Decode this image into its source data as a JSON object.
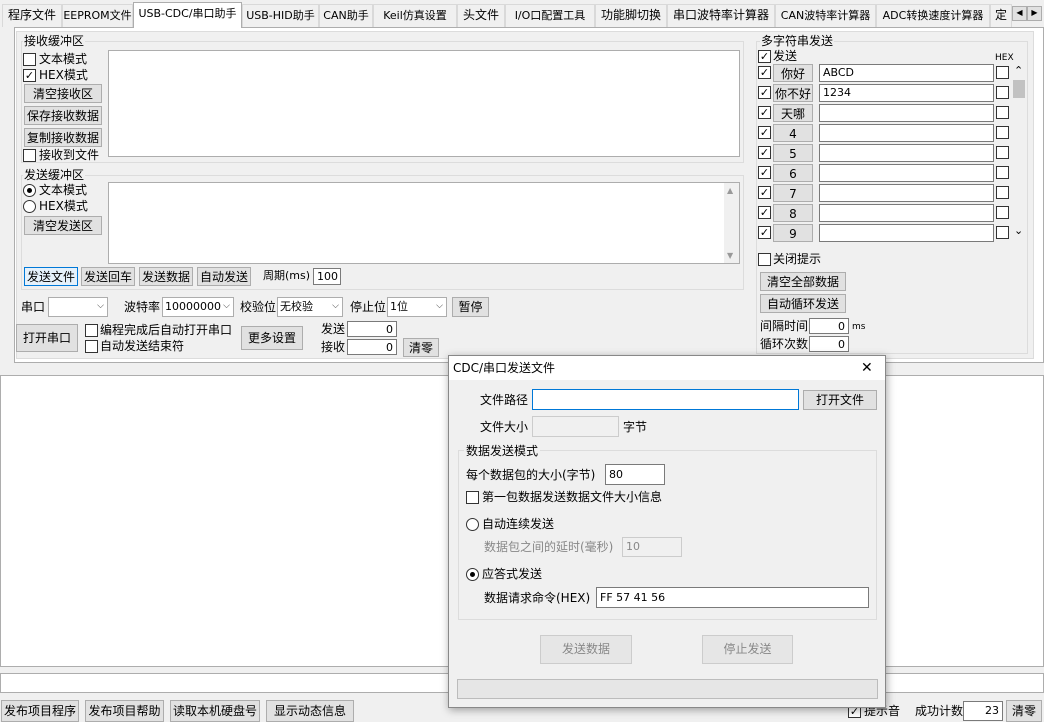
{
  "tabs": [
    "程序文件",
    "EEPROM文件",
    "USB-CDC/串口助手",
    "USB-HID助手",
    "CAN助手",
    "Keil仿真设置",
    "头文件",
    "I/O口配置工具",
    "功能脚切换",
    "串口波特率计算器",
    "CAN波特率计算器",
    "ADC转换速度计算器",
    "定"
  ],
  "tab_scroll": {
    "left": "◀",
    "right": "▶"
  },
  "recv": {
    "title": "接收缓冲区",
    "text_mode": "文本模式",
    "hex_mode": "HEX模式",
    "clear": "清空接收区",
    "save": "保存接收数据",
    "copy": "复制接收数据",
    "to_file": "接收到文件"
  },
  "send": {
    "title": "发送缓冲区",
    "text_mode": "文本模式",
    "hex_mode": "HEX模式",
    "clear": "清空发送区",
    "send_file": "发送文件",
    "send_cr": "发送回车",
    "send_data": "发送数据",
    "auto_send": "自动发送",
    "period_label": "周期(ms)",
    "period_value": "100"
  },
  "port": {
    "port_label": "串口",
    "port_value": "",
    "baud_label": "波特率",
    "baud_value": "10000000",
    "parity_label": "校验位",
    "parity_value": "无校验",
    "stop_label": "停止位",
    "stop_value": "1位",
    "pause": "暂停",
    "open": "打开串口",
    "auto_open": "编程完成后自动打开串口",
    "auto_end": "自动发送结束符",
    "more": "更多设置",
    "sent_label": "发送",
    "sent_value": "0",
    "recv_label": "接收",
    "recv_value": "0",
    "clear": "清零"
  },
  "multi": {
    "title": "多字符串发送",
    "send_col": "发送",
    "hex_col": "HEX",
    "rows": [
      {
        "btn": "你好",
        "text": "ABCD"
      },
      {
        "btn": "你不好",
        "text": "1234"
      },
      {
        "btn": "天哪",
        "text": ""
      },
      {
        "btn": "4",
        "text": ""
      },
      {
        "btn": "5",
        "text": ""
      },
      {
        "btn": "6",
        "text": ""
      },
      {
        "btn": "7",
        "text": ""
      },
      {
        "btn": "8",
        "text": ""
      },
      {
        "btn": "9",
        "text": ""
      }
    ],
    "close_hint": "关闭提示",
    "clear_all": "清空全部数据",
    "auto_loop": "自动循环发送",
    "interval_label": "间隔时间",
    "interval_value": "0",
    "interval_unit": "ms",
    "loop_label": "循环次数",
    "loop_value": "0"
  },
  "bottom": {
    "publish_prog": "发布项目程序",
    "publish_help": "发布项目帮助",
    "read_hd": "读取本机硬盘号",
    "show_dyn": "显示动态信息",
    "beep": "提示音",
    "success_label": "成功计数",
    "success_value": "23",
    "clear": "清零"
  },
  "dialog": {
    "title": "CDC/串口发送文件",
    "close": "✕",
    "path_label": "文件路径",
    "path_value": "",
    "open_file": "打开文件",
    "size_label": "文件大小",
    "size_value": "",
    "size_unit": "字节",
    "mode_title": "数据发送模式",
    "packet_label": "每个数据包的大小(字节)",
    "packet_value": "80",
    "first_packet": "第一包数据发送数据文件大小信息",
    "auto_send": "自动连续发送",
    "delay_label": "数据包之间的延时(毫秒)",
    "delay_value": "10",
    "ack_send": "应答式发送",
    "req_label": "数据请求命令(HEX)",
    "req_value": "FF 57 41 56",
    "send_btn": "发送数据",
    "stop_btn": "停止发送"
  }
}
